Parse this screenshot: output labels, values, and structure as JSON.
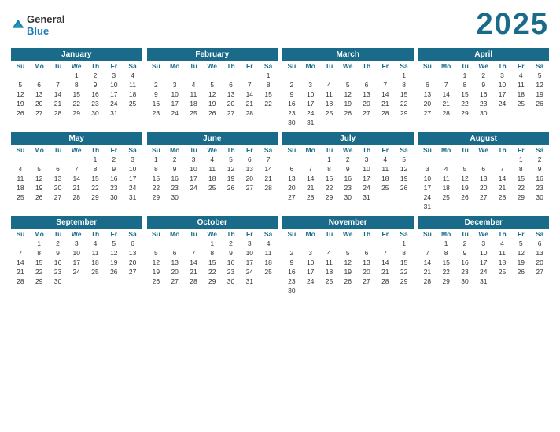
{
  "year": "2025",
  "logo": {
    "general": "General",
    "blue": "Blue"
  },
  "months": [
    {
      "name": "January",
      "days_header": [
        "Su",
        "Mo",
        "Tu",
        "We",
        "Th",
        "Fr",
        "Sa"
      ],
      "weeks": [
        [
          "",
          "",
          "",
          "1",
          "2",
          "3",
          "4"
        ],
        [
          "5",
          "6",
          "7",
          "8",
          "9",
          "10",
          "11"
        ],
        [
          "12",
          "13",
          "14",
          "15",
          "16",
          "17",
          "18"
        ],
        [
          "19",
          "20",
          "21",
          "22",
          "23",
          "24",
          "25"
        ],
        [
          "26",
          "27",
          "28",
          "29",
          "30",
          "31",
          ""
        ]
      ]
    },
    {
      "name": "February",
      "days_header": [
        "Su",
        "Mo",
        "Tu",
        "We",
        "Th",
        "Fr",
        "Sa"
      ],
      "weeks": [
        [
          "",
          "",
          "",
          "",
          "",
          "",
          "1"
        ],
        [
          "2",
          "3",
          "4",
          "5",
          "6",
          "7",
          "8"
        ],
        [
          "9",
          "10",
          "11",
          "12",
          "13",
          "14",
          "15"
        ],
        [
          "16",
          "17",
          "18",
          "19",
          "20",
          "21",
          "22"
        ],
        [
          "23",
          "24",
          "25",
          "26",
          "27",
          "28",
          ""
        ]
      ]
    },
    {
      "name": "March",
      "days_header": [
        "Su",
        "Mo",
        "Tu",
        "We",
        "Th",
        "Fr",
        "Sa"
      ],
      "weeks": [
        [
          "",
          "",
          "",
          "",
          "",
          "",
          "1"
        ],
        [
          "2",
          "3",
          "4",
          "5",
          "6",
          "7",
          "8"
        ],
        [
          "9",
          "10",
          "11",
          "12",
          "13",
          "14",
          "15"
        ],
        [
          "16",
          "17",
          "18",
          "19",
          "20",
          "21",
          "22"
        ],
        [
          "23",
          "24",
          "25",
          "26",
          "27",
          "28",
          "29"
        ],
        [
          "30",
          "31",
          "",
          "",
          "",
          "",
          ""
        ]
      ]
    },
    {
      "name": "April",
      "days_header": [
        "Su",
        "Mo",
        "Tu",
        "We",
        "Th",
        "Fr",
        "Sa"
      ],
      "weeks": [
        [
          "",
          "",
          "1",
          "2",
          "3",
          "4",
          "5"
        ],
        [
          "6",
          "7",
          "8",
          "9",
          "10",
          "11",
          "12"
        ],
        [
          "13",
          "14",
          "15",
          "16",
          "17",
          "18",
          "19"
        ],
        [
          "20",
          "21",
          "22",
          "23",
          "24",
          "25",
          "26"
        ],
        [
          "27",
          "28",
          "29",
          "30",
          "",
          "",
          ""
        ]
      ]
    },
    {
      "name": "May",
      "days_header": [
        "Su",
        "Mo",
        "Tu",
        "We",
        "Th",
        "Fr",
        "Sa"
      ],
      "weeks": [
        [
          "",
          "",
          "",
          "",
          "1",
          "2",
          "3"
        ],
        [
          "4",
          "5",
          "6",
          "7",
          "8",
          "9",
          "10"
        ],
        [
          "11",
          "12",
          "13",
          "14",
          "15",
          "16",
          "17"
        ],
        [
          "18",
          "19",
          "20",
          "21",
          "22",
          "23",
          "24"
        ],
        [
          "25",
          "26",
          "27",
          "28",
          "29",
          "30",
          "31"
        ]
      ]
    },
    {
      "name": "June",
      "days_header": [
        "Su",
        "Mo",
        "Tu",
        "We",
        "Th",
        "Fr",
        "Sa"
      ],
      "weeks": [
        [
          "1",
          "2",
          "3",
          "4",
          "5",
          "6",
          "7"
        ],
        [
          "8",
          "9",
          "10",
          "11",
          "12",
          "13",
          "14"
        ],
        [
          "15",
          "16",
          "17",
          "18",
          "19",
          "20",
          "21"
        ],
        [
          "22",
          "23",
          "24",
          "25",
          "26",
          "27",
          "28"
        ],
        [
          "29",
          "30",
          "",
          "",
          "",
          "",
          ""
        ]
      ]
    },
    {
      "name": "July",
      "days_header": [
        "Su",
        "Mo",
        "Tu",
        "We",
        "Th",
        "Fr",
        "Sa"
      ],
      "weeks": [
        [
          "",
          "",
          "1",
          "2",
          "3",
          "4",
          "5"
        ],
        [
          "6",
          "7",
          "8",
          "9",
          "10",
          "11",
          "12"
        ],
        [
          "13",
          "14",
          "15",
          "16",
          "17",
          "18",
          "19"
        ],
        [
          "20",
          "21",
          "22",
          "23",
          "24",
          "25",
          "26"
        ],
        [
          "27",
          "28",
          "29",
          "30",
          "31",
          "",
          ""
        ]
      ]
    },
    {
      "name": "August",
      "days_header": [
        "Su",
        "Mo",
        "Tu",
        "We",
        "Th",
        "Fr",
        "Sa"
      ],
      "weeks": [
        [
          "",
          "",
          "",
          "",
          "",
          "1",
          "2"
        ],
        [
          "3",
          "4",
          "5",
          "6",
          "7",
          "8",
          "9"
        ],
        [
          "10",
          "11",
          "12",
          "13",
          "14",
          "15",
          "16"
        ],
        [
          "17",
          "18",
          "19",
          "20",
          "21",
          "22",
          "23"
        ],
        [
          "24",
          "25",
          "26",
          "27",
          "28",
          "29",
          "30"
        ],
        [
          "31",
          "",
          "",
          "",
          "",
          "",
          ""
        ]
      ]
    },
    {
      "name": "September",
      "days_header": [
        "Su",
        "Mo",
        "Tu",
        "We",
        "Th",
        "Fr",
        "Sa"
      ],
      "weeks": [
        [
          "",
          "1",
          "2",
          "3",
          "4",
          "5",
          "6"
        ],
        [
          "7",
          "8",
          "9",
          "10",
          "11",
          "12",
          "13"
        ],
        [
          "14",
          "15",
          "16",
          "17",
          "18",
          "19",
          "20"
        ],
        [
          "21",
          "22",
          "23",
          "24",
          "25",
          "26",
          "27"
        ],
        [
          "28",
          "29",
          "30",
          "",
          "",
          "",
          ""
        ]
      ]
    },
    {
      "name": "October",
      "days_header": [
        "Su",
        "Mo",
        "Tu",
        "We",
        "Th",
        "Fr",
        "Sa"
      ],
      "weeks": [
        [
          "",
          "",
          "",
          "1",
          "2",
          "3",
          "4"
        ],
        [
          "5",
          "6",
          "7",
          "8",
          "9",
          "10",
          "11"
        ],
        [
          "12",
          "13",
          "14",
          "15",
          "16",
          "17",
          "18"
        ],
        [
          "19",
          "20",
          "21",
          "22",
          "23",
          "24",
          "25"
        ],
        [
          "26",
          "27",
          "28",
          "29",
          "30",
          "31",
          ""
        ]
      ]
    },
    {
      "name": "November",
      "days_header": [
        "Su",
        "Mo",
        "Tu",
        "We",
        "Th",
        "Fr",
        "Sa"
      ],
      "weeks": [
        [
          "",
          "",
          "",
          "",
          "",
          "",
          "1"
        ],
        [
          "2",
          "3",
          "4",
          "5",
          "6",
          "7",
          "8"
        ],
        [
          "9",
          "10",
          "11",
          "12",
          "13",
          "14",
          "15"
        ],
        [
          "16",
          "17",
          "18",
          "19",
          "20",
          "21",
          "22"
        ],
        [
          "23",
          "24",
          "25",
          "26",
          "27",
          "28",
          "29"
        ],
        [
          "30",
          "",
          "",
          "",
          "",
          "",
          ""
        ]
      ]
    },
    {
      "name": "December",
      "days_header": [
        "Su",
        "Mo",
        "Tu",
        "We",
        "Th",
        "Fr",
        "Sa"
      ],
      "weeks": [
        [
          "",
          "1",
          "2",
          "3",
          "4",
          "5",
          "6"
        ],
        [
          "7",
          "8",
          "9",
          "10",
          "11",
          "12",
          "13"
        ],
        [
          "14",
          "15",
          "16",
          "17",
          "18",
          "19",
          "20"
        ],
        [
          "21",
          "22",
          "23",
          "24",
          "25",
          "26",
          "27"
        ],
        [
          "28",
          "29",
          "30",
          "31",
          "",
          "",
          ""
        ]
      ]
    }
  ]
}
